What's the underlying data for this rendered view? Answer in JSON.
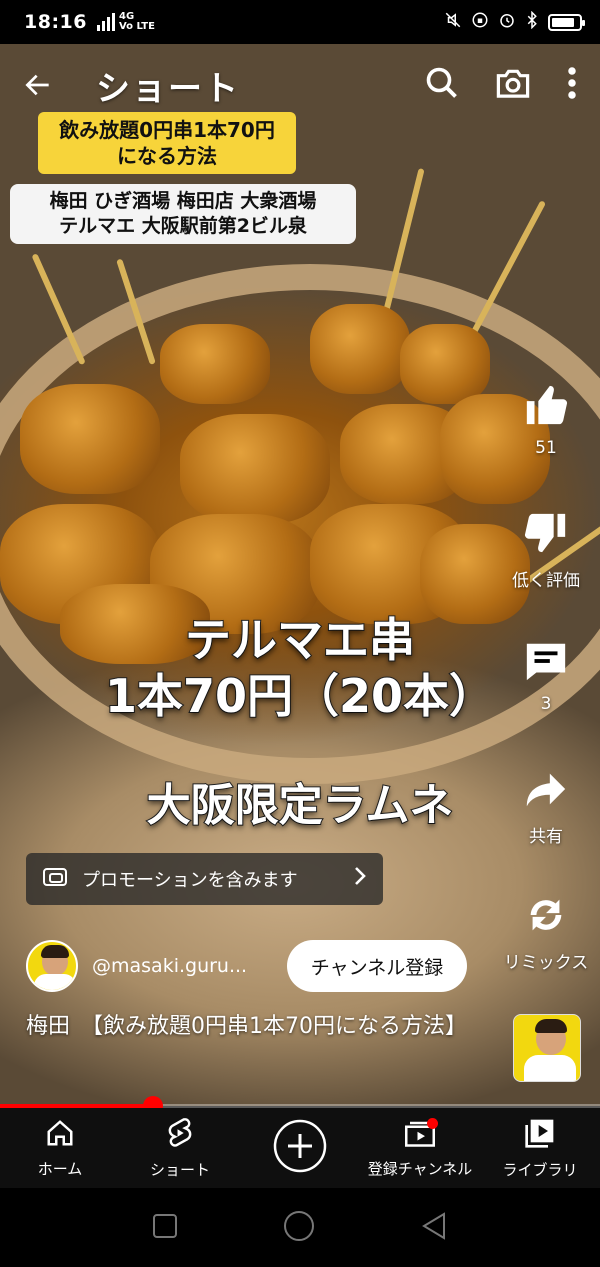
{
  "status_bar": {
    "time": "18:16",
    "network": "4G",
    "volte": "Vo LTE",
    "icons": [
      "mute-icon",
      "lock-rotation-icon",
      "alarm-icon",
      "bluetooth-icon",
      "battery-icon"
    ]
  },
  "header": {
    "title": "ショート",
    "back_icon": "back-arrow-icon",
    "search_icon": "search-icon",
    "camera_icon": "camera-icon",
    "more_icon": "more-vertical-icon"
  },
  "video": {
    "caption_top": "飲み放題0円串1本70円\nになる方法",
    "caption_location": "梅田 ひぎ酒場 梅田店 大衆酒場\nテルマエ 大阪駅前第2ビル泉",
    "overlay_text_1": "テルマエ串\n1本70円（20本）",
    "overlay_text_2": "大阪限定ラムネ"
  },
  "actions": {
    "like_count": "51",
    "dislike_label": "低く評価",
    "comment_count": "3",
    "share_label": "共有",
    "remix_label": "リミックス"
  },
  "promo": {
    "label": "プロモーションを含みます"
  },
  "channel": {
    "handle": "@masaki.guru...",
    "subscribe_label": "チャンネル登録"
  },
  "video_title": "梅田　【飲み放題0円串1本70円になる方法】",
  "progress": 0.255,
  "bottom_nav": [
    {
      "label": "ホーム",
      "icon": "home-icon"
    },
    {
      "label": "ショート",
      "icon": "shorts-icon"
    },
    {
      "label": "",
      "icon": "create-plus-icon"
    },
    {
      "label": "登録チャンネル",
      "icon": "subscriptions-icon"
    },
    {
      "label": "ライブラリ",
      "icon": "library-icon"
    }
  ],
  "colors": {
    "accent": "#ff0000",
    "caption_yellow": "#f7d43a"
  }
}
